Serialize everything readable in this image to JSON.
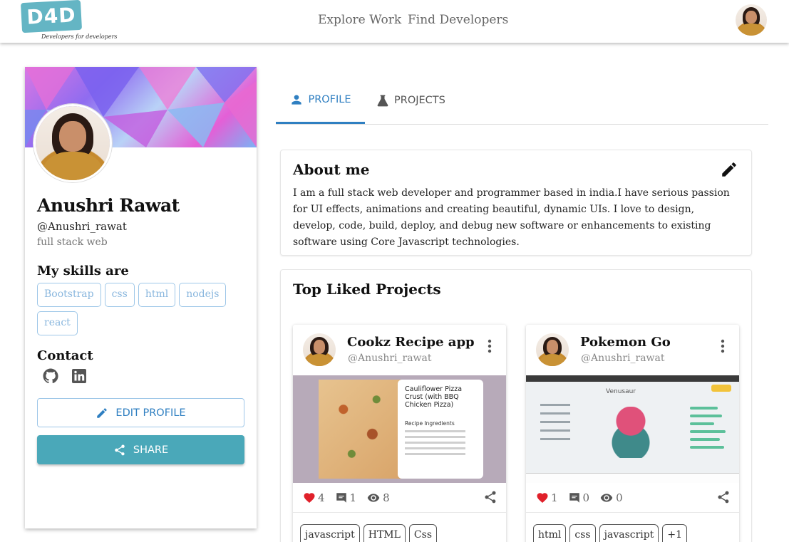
{
  "header": {
    "logo_text": "D4D",
    "logo_tagline": "Developers for developers",
    "nav": [
      "Explore Work",
      "Find Developers"
    ]
  },
  "profile": {
    "name": "Anushri Rawat",
    "handle": "@Anushri_rawat",
    "headline": "full stack web",
    "skills_title": "My skills are",
    "skills": [
      "Bootstrap",
      "css",
      "html",
      "nodejs",
      "react"
    ],
    "contact_title": "Contact",
    "contact_icons": [
      "github-icon",
      "linkedin-icon"
    ],
    "edit_button": "EDIT PROFILE",
    "share_button": "SHARE"
  },
  "tabs": [
    {
      "label": "PROFILE",
      "icon": "person-icon",
      "active": true
    },
    {
      "label": "PROJECTS",
      "icon": "flask-icon",
      "active": false
    }
  ],
  "about": {
    "title": "About me",
    "text": "I am a full stack web developer and programmer based in india.I have serious passion for UI effects, animations and creating beautiful, dynamic UIs. I love to design, develop, code, build, deploy, and debug new software or enhancements to existing software using Core Javascript technologies."
  },
  "top_liked": {
    "title": "Top Liked Projects",
    "projects": [
      {
        "title": "Cookz Recipe app",
        "handle": "@Anushri_rawat",
        "likes": "4",
        "comments": "1",
        "views": "8",
        "tags": [
          "javascript",
          "HTML",
          "Css"
        ],
        "preview_title": "Cauliflower Pizza Crust (with BBQ Chicken Pizza)",
        "preview_section": "Recipe Ingredients"
      },
      {
        "title": "Pokemon Go",
        "handle": "@Anushri_rawat",
        "likes": "1",
        "comments": "0",
        "views": "0",
        "tags": [
          "html",
          "css",
          "javascript",
          "+1"
        ],
        "preview_title": "Venusaur"
      }
    ]
  },
  "colors": {
    "accent": "#2f7fc1",
    "share": "#4aa8b9",
    "like": "#e0202a",
    "logo": "#64b5c4"
  }
}
